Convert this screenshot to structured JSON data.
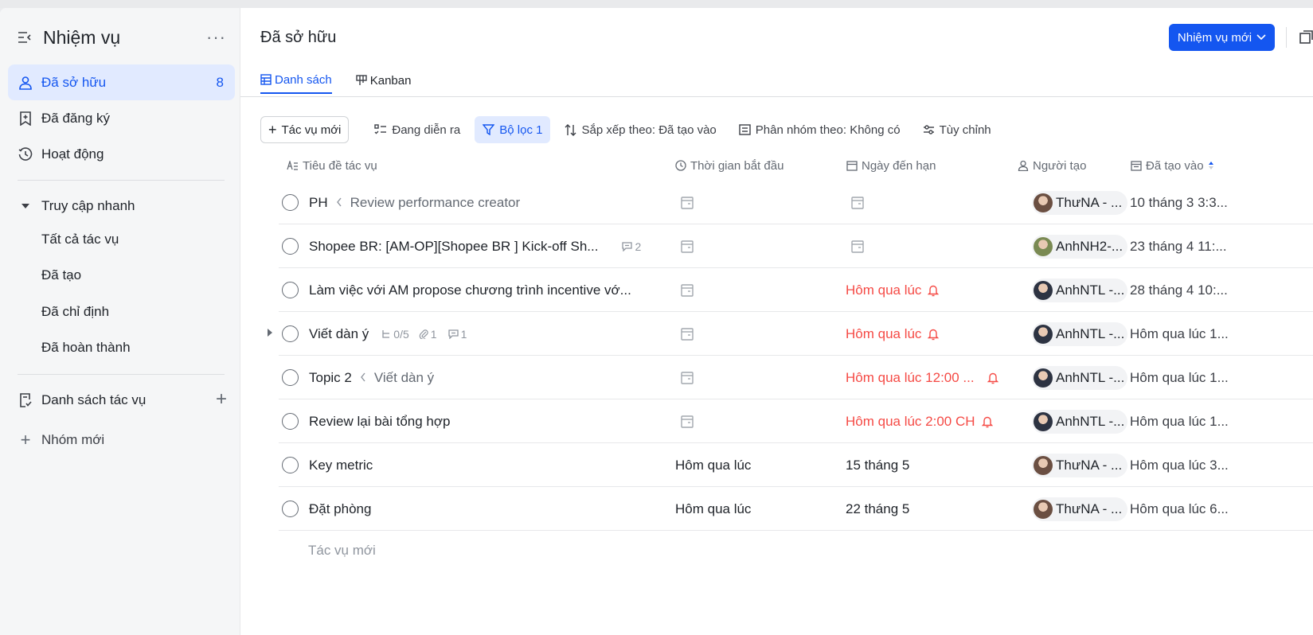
{
  "sidebar": {
    "title": "Nhiệm vụ",
    "more": "···",
    "nav": [
      {
        "label": "Đã sở hữu",
        "count": "8"
      },
      {
        "label": "Đã đăng ký"
      },
      {
        "label": "Hoạt động"
      }
    ],
    "quick_access": {
      "label": "Truy cập nhanh",
      "items": [
        "Tất cả tác vụ",
        "Đã tạo",
        "Đã chỉ định",
        "Đã hoàn thành"
      ]
    },
    "task_lists": {
      "label": "Danh sách tác vụ",
      "add": "+"
    },
    "new_group": "Nhóm mới",
    "new_group_plus": "+"
  },
  "main": {
    "title": "Đã sở hữu",
    "new_task_button": "Nhiệm vụ mới",
    "tabs": [
      {
        "label": "Danh sách"
      },
      {
        "label": "Kanban"
      }
    ],
    "toolbar": {
      "new_task": "Tác vụ mới",
      "ongoing": "Đang diễn ra",
      "filter": "Bộ lọc 1",
      "sort": "Sắp xếp theo: Đã tạo vào",
      "group": "Phân nhóm theo: Không có",
      "customize": "Tùy chỉnh"
    },
    "columns": {
      "title": "Tiêu đề tác vụ",
      "start": "Thời gian bắt đầu",
      "due": "Ngày đến hạn",
      "creator": "Người tạo",
      "created": "Đã tạo vào"
    },
    "tasks": [
      {
        "title": "PH",
        "parent": "Review performance creator",
        "start": "",
        "due": "",
        "due_overdue": false,
        "creator": "ThưNA - ...",
        "created": "10 tháng 3 3:3..."
      },
      {
        "title": "Shopee BR: [AM-OP][Shopee BR ] Kick-off Sh...",
        "comments": "2",
        "start": "",
        "due": "",
        "due_overdue": false,
        "creator": "AnhNH2-...",
        "created": "23 tháng 4 11:..."
      },
      {
        "title": "Làm việc với AM propose chương trình incentive vớ...",
        "start": "",
        "due": "Hôm qua lúc",
        "due_overdue": true,
        "creator": "AnhNTL -...",
        "created": "28 tháng 4 10:..."
      },
      {
        "title": "Viết dàn ý",
        "subtasks": "0/5",
        "attachments": "1",
        "comments": "1",
        "start": "",
        "due": "Hôm qua lúc",
        "due_overdue": true,
        "creator": "AnhNTL -...",
        "created": "Hôm qua lúc 1..."
      },
      {
        "title": "Topic 2",
        "parent": "Viết dàn ý",
        "start": "",
        "due": "Hôm qua lúc 12:00 ...",
        "due_overdue": true,
        "creator": "AnhNTL -...",
        "created": "Hôm qua lúc 1..."
      },
      {
        "title": "Review lại bài tổng hợp",
        "start": "",
        "due": "Hôm qua lúc 2:00 CH",
        "due_overdue": true,
        "creator": "AnhNTL -...",
        "created": "Hôm qua lúc 1..."
      },
      {
        "title": "Key metric",
        "start": "Hôm qua lúc",
        "due": "15 tháng 5",
        "due_overdue": false,
        "creator": "ThưNA - ...",
        "created": "Hôm qua lúc 3..."
      },
      {
        "title": "Đặt phòng",
        "start": "Hôm qua lúc",
        "due": "22 tháng 5",
        "due_overdue": false,
        "creator": "ThưNA - ...",
        "created": "Hôm qua lúc 6..."
      }
    ],
    "new_task_placeholder": "Tác vụ mới"
  },
  "colors": {
    "accent": "#1456f0",
    "overdue": "#f54a45",
    "active_bg": "#e1eaff"
  }
}
